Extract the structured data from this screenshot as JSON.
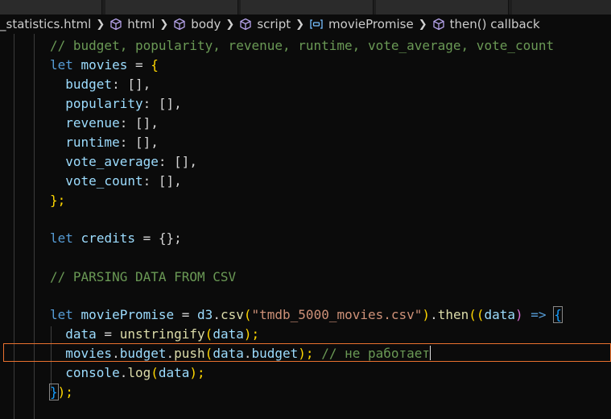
{
  "breadcrumb": {
    "file": "_statistics.html",
    "items": [
      "html",
      "body",
      "script",
      "moviePromise",
      "then() callback"
    ]
  },
  "code": {
    "l1_comment": "// budget, popularity, revenue, runtime, vote_average, vote_count",
    "l2_kw": "let",
    "l2_var": "movies",
    "l2_rest": " = ",
    "l2_brace": "{",
    "fields": [
      "budget",
      "popularity",
      "revenue",
      "runtime",
      "vote_average",
      "vote_count"
    ],
    "field_val": ": [],",
    "close_obj": "};",
    "credits_kw": "let",
    "credits_var": "credits",
    "credits_rest": " = {};",
    "parse_comment": "// PARSING DATA FROM CSV",
    "promise_kw": "let",
    "promise_var": "moviePromise",
    "eq": " = ",
    "d3": "d3",
    "dot": ".",
    "csv": "csv",
    "paren_open": "(",
    "csv_file": "\"tmdb_5000_movies.csv\"",
    "paren_close": ")",
    "then": "then",
    "arrow_open": "((",
    "data_param": "data",
    "arrow_mid": ") ",
    "arrow": "=>",
    "arrow_brace": "{",
    "body1_var": "data",
    "body1_eq": " = ",
    "body1_fn": "unstringify",
    "body1_arg": "data",
    "body1_end": ");",
    "body2_movies": "movies",
    "body2_budget": "budget",
    "body2_push": "push",
    "body2_data": "data",
    "body2_budget2": "budget",
    "body2_end": "); ",
    "body2_comment": "// не работает",
    "body3_console": "console",
    "body3_log": "log",
    "body3_data": "data",
    "body3_end": ");",
    "close_promise_brace": "}",
    "close_promise_rest": ");"
  }
}
